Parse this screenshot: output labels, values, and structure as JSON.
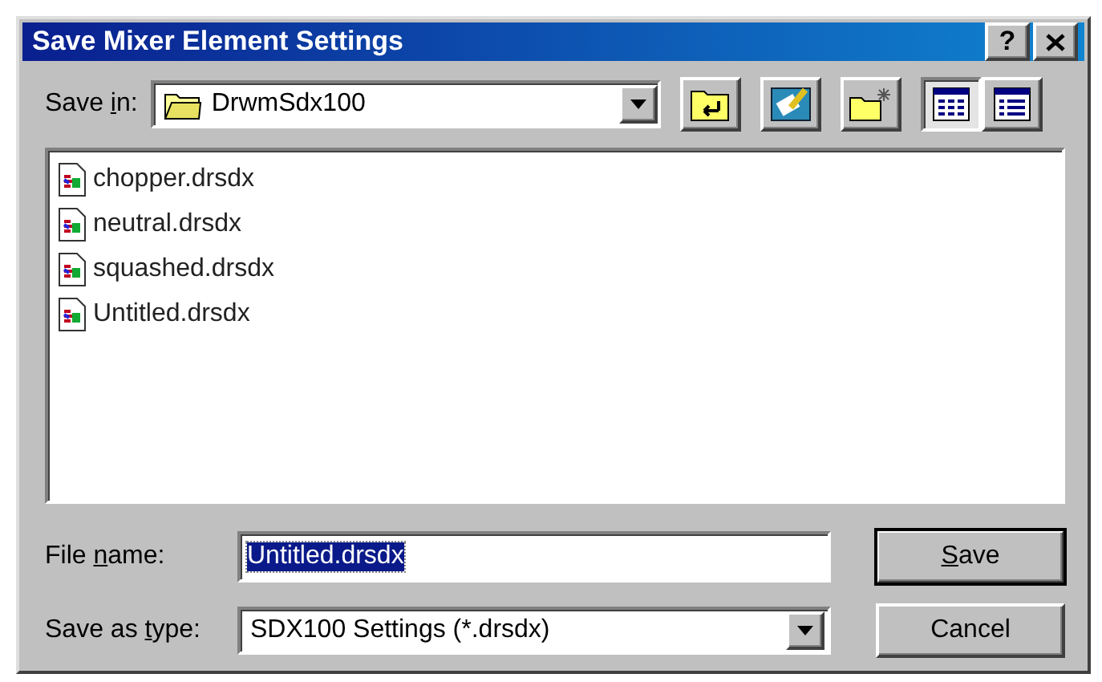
{
  "window": {
    "title": "Save Mixer Element Settings",
    "help_label": "?"
  },
  "save_in": {
    "label": {
      "before": "Save ",
      "key": "i",
      "after": "n:"
    },
    "value": "DrwmSdx100"
  },
  "toolbar": [
    {
      "kind": "up-folder",
      "selected": false
    },
    {
      "kind": "desktop",
      "selected": false
    },
    {
      "kind": "new-folder",
      "selected": false
    },
    {
      "kind": "list-view",
      "selected": true
    },
    {
      "kind": "details-view",
      "selected": false
    }
  ],
  "files": [
    {
      "name": "chopper.drsdx"
    },
    {
      "name": "neutral.drsdx"
    },
    {
      "name": "squashed.drsdx"
    },
    {
      "name": "Untitled.drsdx"
    }
  ],
  "file_name": {
    "label": {
      "before": "File ",
      "key": "n",
      "after": "ame:"
    },
    "value": "Untitled.drsdx",
    "highlighted": true
  },
  "save_as_type": {
    "label": {
      "before": "Save as ",
      "key": "t",
      "after": "ype:"
    },
    "value": "SDX100 Settings (*.drsdx)"
  },
  "buttons": [
    {
      "label": {
        "key": "S",
        "after": "ave"
      },
      "default": true
    },
    {
      "label": {
        "before": "Cancel"
      },
      "default": false
    }
  ]
}
